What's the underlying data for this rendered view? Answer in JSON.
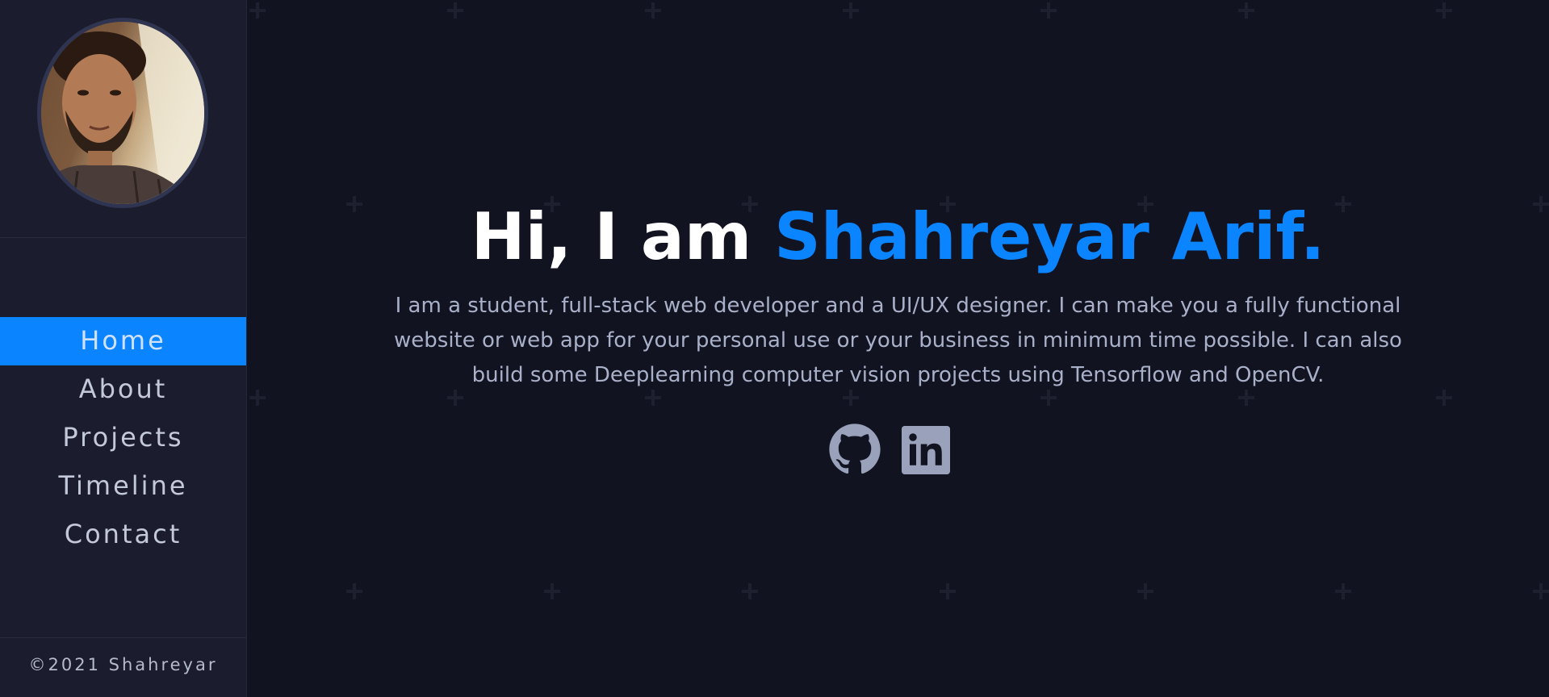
{
  "sidebar": {
    "nav": [
      {
        "label": "Home",
        "active": true
      },
      {
        "label": "About"
      },
      {
        "label": "Projects"
      },
      {
        "label": "Timeline"
      },
      {
        "label": "Contact"
      }
    ],
    "footer": "©2021 Shahreyar"
  },
  "hero": {
    "greeting": "Hi, I am ",
    "name": "Shahreyar Arif.",
    "intro": "I am a student, full-stack web developer and a UI/UX designer. I can make you a fully functional website or web app for your personal use or your business in minimum time possible. I can also build some Deeplearning computer vision projects using Tensorflow and OpenCV."
  },
  "socials": [
    {
      "icon": "github-icon"
    },
    {
      "icon": "linkedin-icon"
    }
  ],
  "colors": {
    "accent": "#0b84ff",
    "background": "#121320",
    "sidebar": "#1b1d2e",
    "text_muted": "#a9b0c9"
  }
}
